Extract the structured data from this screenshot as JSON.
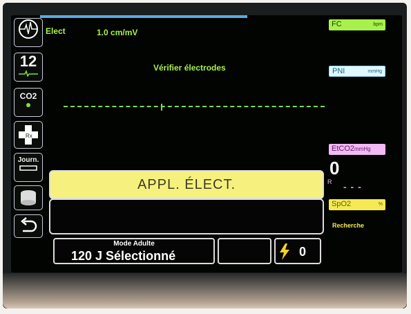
{
  "colors": {
    "waveform_green": "#a8f14a",
    "hr_label": "#a8f14a",
    "nibp_label": "#dff8ff",
    "etco2_label": "#f3b9f5",
    "spo2_label": "#f5ea55",
    "alarm_banner": "#f6f17f"
  },
  "sidebar": {
    "buttons": [
      {
        "name": "ecg-lead-button",
        "icon": "ecg-circle-icon",
        "label": ""
      },
      {
        "name": "twelve-lead-button",
        "icon": "ecg-wave-icon",
        "label": "12"
      },
      {
        "name": "co2-button",
        "icon": "dot-icon",
        "label": "CO2"
      },
      {
        "name": "rx-button",
        "icon": "rx-cross-icon",
        "label": ""
      },
      {
        "name": "journal-button",
        "icon": "bar-icon",
        "label": "Journ."
      },
      {
        "name": "nibp-cuff-button",
        "icon": "cuff-icon",
        "label": ""
      },
      {
        "name": "back-button",
        "icon": "back-arrow-icon",
        "label": ""
      }
    ]
  },
  "ecg": {
    "lead": "Elect",
    "gain": "1.0 cm/mV",
    "message": "Vérifier électrodes"
  },
  "vitals": {
    "hr_label": "FC",
    "hr_unit": "bpm",
    "nibp_label": "PNI",
    "nibp_unit": "mmHg",
    "etco2_label": "EtCO2",
    "etco2_unit": "mmHg",
    "etco2_value": "0",
    "resp_label": "R",
    "resp_value": "- - -",
    "spo2_label": "SpO2",
    "spo2_unit": "%",
    "spo2_status": "Recherche"
  },
  "alarm": {
    "message": "APPL. ÉLECT."
  },
  "defib": {
    "mode": "Mode Adulte",
    "energy": "120 J  Sélectionné",
    "shock_count": "0"
  }
}
